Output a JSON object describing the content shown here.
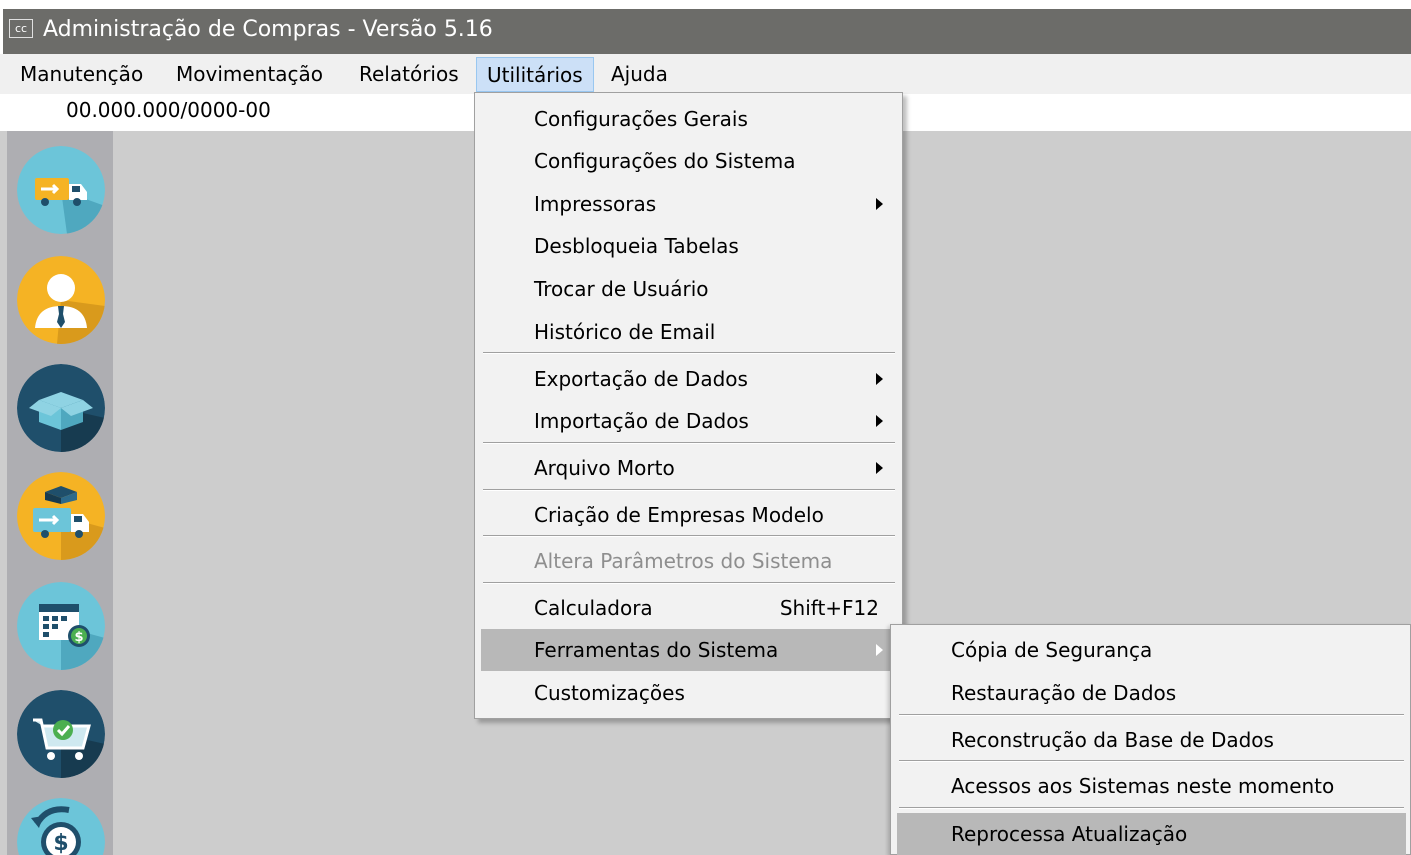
{
  "window": {
    "icon_text": "cc",
    "title": "Administração de Compras - Versão 5.16"
  },
  "menubar": {
    "items": [
      {
        "label": "Manutenção"
      },
      {
        "label": "Movimentação"
      },
      {
        "label": "Relatórios"
      },
      {
        "label": "Utilitários",
        "active": true
      },
      {
        "label": "Ajuda"
      }
    ]
  },
  "company": {
    "cnpj": "00.000.000/0000-00"
  },
  "toolbar": {
    "buttons": [
      {
        "icon": "delivery-truck-icon",
        "color": "#6cc5d9"
      },
      {
        "icon": "user-icon",
        "color": "#f5b324"
      },
      {
        "icon": "open-box-icon",
        "color": "#1f4f6b"
      },
      {
        "icon": "truck-with-box-icon",
        "color": "#f5b324"
      },
      {
        "icon": "calendar-money-icon",
        "color": "#6cc5d9"
      },
      {
        "icon": "shopping-cart-check-icon",
        "color": "#1f4f6b"
      },
      {
        "icon": "money-refund-icon",
        "color": "#6cc5d9"
      }
    ]
  },
  "utilitarios_menu": {
    "items": [
      {
        "label": "Configurações Gerais"
      },
      {
        "label": "Configurações do Sistema"
      },
      {
        "label": "Impressoras",
        "submenu": true
      },
      {
        "label": "Desbloqueia Tabelas"
      },
      {
        "label": "Trocar de Usuário"
      },
      {
        "label": "Histórico de Email"
      },
      {
        "label": "Exportação de Dados",
        "submenu": true
      },
      {
        "label": "Importação de Dados",
        "submenu": true
      },
      {
        "label": "Arquivo Morto",
        "submenu": true
      },
      {
        "label": "Criação de Empresas Modelo"
      },
      {
        "label": "Altera Parâmetros do Sistema",
        "disabled": true
      },
      {
        "label": "Calculadora",
        "shortcut": "Shift+F12"
      },
      {
        "label": "Ferramentas do Sistema",
        "submenu": true,
        "highlighted": true
      },
      {
        "label": "Customizações"
      }
    ]
  },
  "ferramentas_submenu": {
    "items": [
      {
        "label": "Cópia de Segurança"
      },
      {
        "label": "Restauração de Dados"
      },
      {
        "label": "Reconstrução da Base de Dados"
      },
      {
        "label": "Acessos aos Sistemas neste momento"
      },
      {
        "label": "Reprocessa Atualização",
        "highlighted": true
      }
    ]
  }
}
